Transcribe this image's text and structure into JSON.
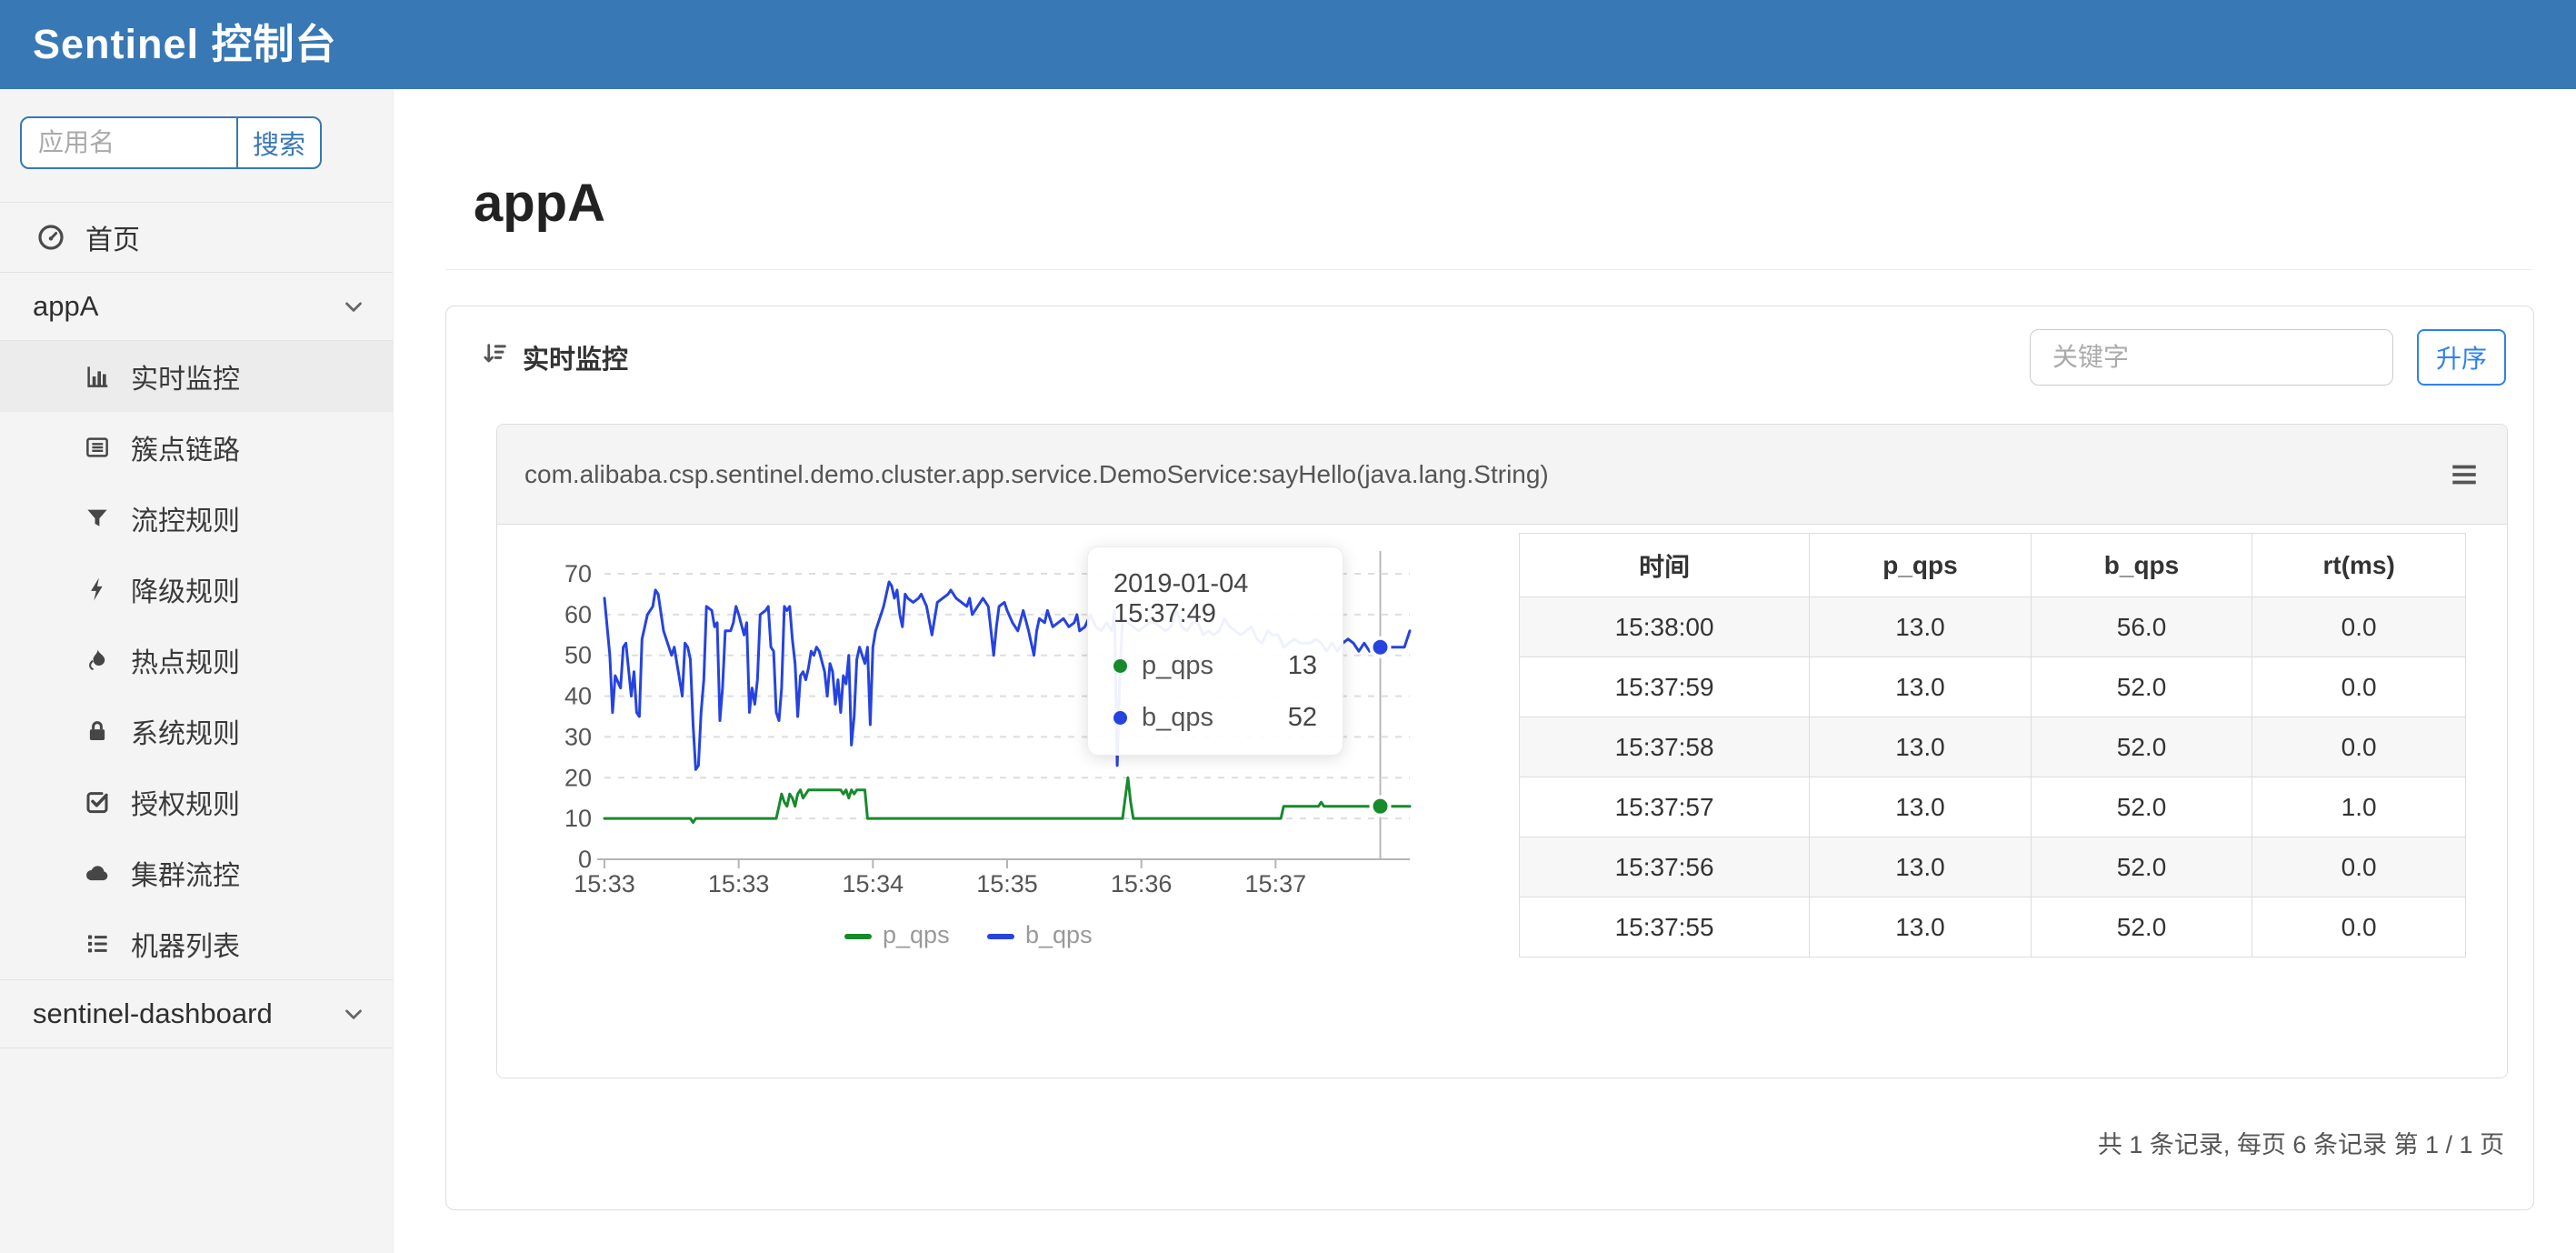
{
  "brand": {
    "title": "Sentinel 控制台"
  },
  "colors": {
    "header_bg": "#3878b4",
    "accent_blue": "#2e80f0",
    "p_qps_green": "#178a2c",
    "b_qps_blue": "#2643e0"
  },
  "sidebar": {
    "search": {
      "placeholder": "应用名",
      "button_label": "搜索"
    },
    "home": {
      "label": "首页",
      "icon": "gauge-icon"
    },
    "groups": [
      {
        "label": "appA",
        "chevron": "down",
        "items": [
          {
            "label": "实时监控",
            "icon": "bar-chart-icon",
            "active": true
          },
          {
            "label": "簇点链路",
            "icon": "list-icon",
            "active": false
          },
          {
            "label": "流控规则",
            "icon": "filter-icon",
            "active": false
          },
          {
            "label": "降级规则",
            "icon": "bolt-icon",
            "active": false
          },
          {
            "label": "热点规则",
            "icon": "fire-icon",
            "active": false
          },
          {
            "label": "系统规则",
            "icon": "lock-icon",
            "active": false
          },
          {
            "label": "授权规则",
            "icon": "check-icon",
            "active": false
          },
          {
            "label": "集群流控",
            "icon": "cloud-icon",
            "active": false
          },
          {
            "label": "机器列表",
            "icon": "machines-icon",
            "active": false
          }
        ]
      },
      {
        "label": "sentinel-dashboard",
        "chevron": "down",
        "items": []
      }
    ]
  },
  "main": {
    "page_title": "appA",
    "monitor_panel": {
      "title": "实时监控",
      "keyword_placeholder": "关键字",
      "sort_button_label": "升序",
      "resource_name": "com.alibaba.csp.sentinel.demo.cluster.app.service.DemoService:sayHello(java.lang.String)",
      "pagination_text": "共 1 条记录, 每页 6 条记录 第 1 / 1 页"
    },
    "metrics_table": {
      "headers": [
        "时间",
        "p_qps",
        "b_qps",
        "rt(ms)"
      ],
      "rows": [
        [
          "15:38:00",
          "13.0",
          "56.0",
          "0.0"
        ],
        [
          "15:37:59",
          "13.0",
          "52.0",
          "0.0"
        ],
        [
          "15:37:58",
          "13.0",
          "52.0",
          "0.0"
        ],
        [
          "15:37:57",
          "13.0",
          "52.0",
          "1.0"
        ],
        [
          "15:37:56",
          "13.0",
          "52.0",
          "0.0"
        ],
        [
          "15:37:55",
          "13.0",
          "52.0",
          "0.0"
        ]
      ]
    }
  },
  "chart_data": {
    "type": "line",
    "title": "",
    "xlabel": "",
    "ylabel": "",
    "x_range_seconds": [
      0,
      300
    ],
    "x_tick_seconds": [
      0,
      50,
      100,
      150,
      200,
      250
    ],
    "x_tick_labels": [
      "15:33",
      "15:33",
      "15:34",
      "15:35",
      "15:36",
      "15:37"
    ],
    "ylim": [
      0,
      70
    ],
    "y_ticks": [
      0,
      10,
      20,
      30,
      40,
      50,
      60,
      70
    ],
    "grid": "dashed-horizontal",
    "legend_position": "bottom-center",
    "series": [
      {
        "name": "p_qps",
        "color": "#178a2c",
        "points": [
          [
            0,
            10
          ],
          [
            15,
            10
          ],
          [
            32,
            10
          ],
          [
            33,
            9
          ],
          [
            34,
            10
          ],
          [
            55,
            10
          ],
          [
            64,
            10
          ],
          [
            65,
            13
          ],
          [
            66,
            16
          ],
          [
            67,
            14
          ],
          [
            68,
            13
          ],
          [
            69,
            16
          ],
          [
            70,
            15
          ],
          [
            71,
            13
          ],
          [
            72,
            16
          ],
          [
            73,
            17
          ],
          [
            74,
            15
          ],
          [
            76,
            17
          ],
          [
            80,
            17
          ],
          [
            84,
            17
          ],
          [
            88,
            17
          ],
          [
            89,
            16
          ],
          [
            90,
            17
          ],
          [
            91,
            15
          ],
          [
            92,
            17
          ],
          [
            93,
            16
          ],
          [
            94,
            17
          ],
          [
            96,
            17
          ],
          [
            97,
            17
          ],
          [
            98,
            10
          ],
          [
            110,
            10
          ],
          [
            130,
            10
          ],
          [
            150,
            10
          ],
          [
            170,
            10
          ],
          [
            193,
            10
          ],
          [
            194,
            15
          ],
          [
            195,
            20
          ],
          [
            196,
            14
          ],
          [
            197,
            10
          ],
          [
            210,
            10
          ],
          [
            230,
            10
          ],
          [
            250,
            10
          ],
          [
            252,
            10
          ],
          [
            253,
            13
          ],
          [
            258,
            13
          ],
          [
            263,
            13
          ],
          [
            266,
            13
          ],
          [
            267,
            14
          ],
          [
            268,
            13
          ],
          [
            275,
            13
          ],
          [
            285,
            13
          ],
          [
            289,
            13
          ],
          [
            295,
            13
          ],
          [
            300,
            13
          ]
        ]
      },
      {
        "name": "b_qps",
        "color": "#2643e0",
        "points": [
          [
            0,
            64
          ],
          [
            2,
            50
          ],
          [
            3,
            36
          ],
          [
            4,
            45
          ],
          [
            6,
            42
          ],
          [
            7,
            52
          ],
          [
            8,
            53
          ],
          [
            10,
            40
          ],
          [
            11,
            46
          ],
          [
            12,
            36
          ],
          [
            13,
            35
          ],
          [
            14,
            54
          ],
          [
            16,
            60
          ],
          [
            18,
            62
          ],
          [
            19,
            66
          ],
          [
            20,
            65
          ],
          [
            22,
            56
          ],
          [
            24,
            52
          ],
          [
            25,
            50
          ],
          [
            26,
            52
          ],
          [
            28,
            44
          ],
          [
            29,
            40
          ],
          [
            30,
            53
          ],
          [
            31,
            52
          ],
          [
            32,
            49
          ],
          [
            33,
            33
          ],
          [
            34,
            22
          ],
          [
            35,
            23
          ],
          [
            36,
            36
          ],
          [
            37,
            44
          ],
          [
            38,
            62
          ],
          [
            40,
            61
          ],
          [
            41,
            57
          ],
          [
            42,
            58
          ],
          [
            43,
            34
          ],
          [
            44,
            42
          ],
          [
            45,
            56
          ],
          [
            47,
            56
          ],
          [
            48,
            58
          ],
          [
            49,
            62
          ],
          [
            50,
            60
          ],
          [
            52,
            55
          ],
          [
            53,
            58
          ],
          [
            54,
            36
          ],
          [
            55,
            42
          ],
          [
            56,
            38
          ],
          [
            57,
            44
          ],
          [
            58,
            60
          ],
          [
            60,
            61
          ],
          [
            61,
            62
          ],
          [
            62,
            52
          ],
          [
            63,
            51
          ],
          [
            64,
            36
          ],
          [
            65,
            34
          ],
          [
            66,
            42
          ],
          [
            67,
            62
          ],
          [
            68,
            61
          ],
          [
            69,
            62
          ],
          [
            70,
            54
          ],
          [
            71,
            48
          ],
          [
            72,
            35
          ],
          [
            73,
            45
          ],
          [
            74,
            46
          ],
          [
            75,
            44
          ],
          [
            76,
            47
          ],
          [
            77,
            51
          ],
          [
            78,
            50
          ],
          [
            79,
            52
          ],
          [
            80,
            51
          ],
          [
            82,
            46
          ],
          [
            83,
            40
          ],
          [
            84,
            48
          ],
          [
            85,
            46
          ],
          [
            86,
            38
          ],
          [
            87,
            44
          ],
          [
            88,
            36
          ],
          [
            89,
            45
          ],
          [
            90,
            43
          ],
          [
            91,
            50
          ],
          [
            92,
            28
          ],
          [
            93,
            35
          ],
          [
            94,
            49
          ],
          [
            95,
            52
          ],
          [
            96,
            50
          ],
          [
            97,
            48
          ],
          [
            98,
            52
          ],
          [
            99,
            33
          ],
          [
            100,
            52
          ],
          [
            101,
            56
          ],
          [
            103,
            60
          ],
          [
            104,
            62
          ],
          [
            106,
            68
          ],
          [
            107,
            67
          ],
          [
            108,
            64
          ],
          [
            109,
            66
          ],
          [
            110,
            60
          ],
          [
            111,
            57
          ],
          [
            112,
            65
          ],
          [
            113,
            64
          ],
          [
            115,
            63
          ],
          [
            117,
            64
          ],
          [
            118,
            65
          ],
          [
            120,
            62
          ],
          [
            122,
            55
          ],
          [
            124,
            63
          ],
          [
            126,
            64
          ],
          [
            128,
            65
          ],
          [
            129,
            66
          ],
          [
            131,
            64
          ],
          [
            133,
            63
          ],
          [
            135,
            62
          ],
          [
            136,
            64
          ],
          [
            137,
            60
          ],
          [
            139,
            62
          ],
          [
            141,
            64
          ],
          [
            143,
            62
          ],
          [
            145,
            50
          ],
          [
            146,
            57
          ],
          [
            147,
            62
          ],
          [
            149,
            63
          ],
          [
            150,
            61
          ],
          [
            152,
            58
          ],
          [
            154,
            56
          ],
          [
            156,
            61
          ],
          [
            158,
            56
          ],
          [
            160,
            50
          ],
          [
            161,
            56
          ],
          [
            162,
            59
          ],
          [
            164,
            58
          ],
          [
            165,
            61
          ],
          [
            167,
            57
          ],
          [
            169,
            58
          ],
          [
            171,
            59
          ],
          [
            173,
            57
          ],
          [
            175,
            58
          ],
          [
            176,
            60
          ],
          [
            177,
            56
          ],
          [
            179,
            57
          ],
          [
            181,
            60
          ],
          [
            183,
            57
          ],
          [
            185,
            56
          ],
          [
            187,
            58
          ],
          [
            189,
            56
          ],
          [
            190,
            61
          ],
          [
            191,
            23
          ],
          [
            192,
            45
          ],
          [
            193,
            59
          ],
          [
            195,
            58
          ],
          [
            197,
            57
          ],
          [
            199,
            56
          ],
          [
            201,
            57
          ],
          [
            203,
            58
          ],
          [
            205,
            58
          ],
          [
            207,
            57
          ],
          [
            209,
            56
          ],
          [
            211,
            57
          ],
          [
            213,
            61
          ],
          [
            215,
            57
          ],
          [
            217,
            56
          ],
          [
            219,
            58
          ],
          [
            221,
            58
          ],
          [
            223,
            55
          ],
          [
            225,
            56
          ],
          [
            227,
            55
          ],
          [
            229,
            56
          ],
          [
            231,
            59
          ],
          [
            233,
            57
          ],
          [
            235,
            56
          ],
          [
            237,
            55
          ],
          [
            239,
            56
          ],
          [
            241,
            57
          ],
          [
            243,
            54
          ],
          [
            245,
            53
          ],
          [
            247,
            56
          ],
          [
            249,
            55
          ],
          [
            251,
            55
          ],
          [
            253,
            52
          ],
          [
            255,
            53
          ],
          [
            257,
            54
          ],
          [
            259,
            53
          ],
          [
            261,
            53
          ],
          [
            263,
            53
          ],
          [
            265,
            54
          ],
          [
            267,
            53
          ],
          [
            269,
            51
          ],
          [
            271,
            53
          ],
          [
            273,
            51
          ],
          [
            275,
            53
          ],
          [
            277,
            54
          ],
          [
            279,
            53
          ],
          [
            281,
            51
          ],
          [
            283,
            53
          ],
          [
            285,
            51
          ],
          [
            286,
            52
          ],
          [
            288,
            51
          ],
          [
            289,
            52
          ],
          [
            291,
            53
          ],
          [
            293,
            52
          ],
          [
            295,
            52
          ],
          [
            297,
            52
          ],
          [
            298,
            52
          ],
          [
            300,
            56
          ]
        ]
      }
    ],
    "hover": {
      "t": 289,
      "line_color": "#b8b8b8"
    },
    "tooltip": {
      "title": "2019-01-04 15:37:49",
      "rows": [
        {
          "name": "p_qps",
          "value": "13",
          "color": "#178a2c"
        },
        {
          "name": "b_qps",
          "value": "52",
          "color": "#2643e0"
        }
      ]
    }
  }
}
